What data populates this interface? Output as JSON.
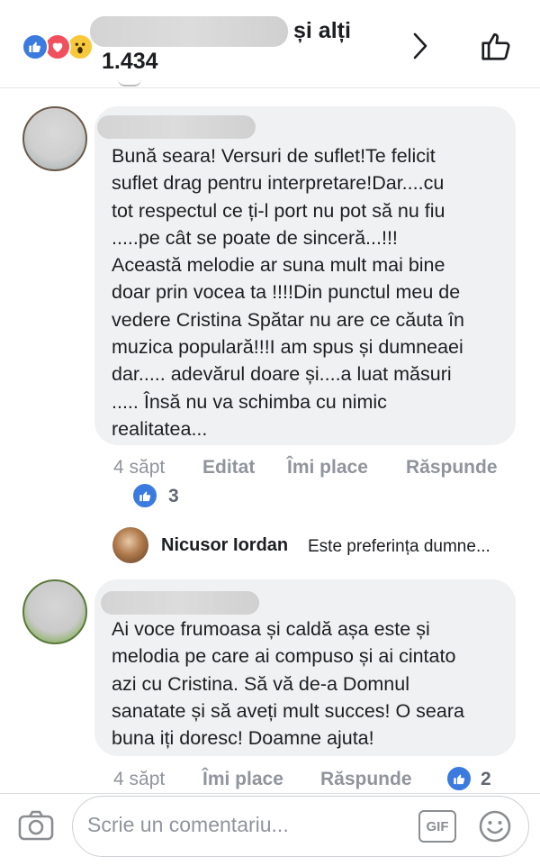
{
  "header": {
    "reactions_suffix": "și alți",
    "reactions_count": "1.434"
  },
  "comments": [
    {
      "text": "Bună seara! Versuri de suflet!Te felicit\nsuflet drag pentru interpretare!Dar....cu\ntot respectul ce ți-l port nu pot să nu fiu\n.....pe cât se poate de sinceră...!!!\nAceastă melodie ar suna mult mai bine\ndoar prin vocea ta !!!!Din punctul meu de\nvedere Cristina Spătar nu are ce căuta în\nmuzica populară!!!I am spus și dumneaei\ndar..... adevărul doare și....a luat măsuri\n..... Însă nu va schimba cu nimic\nrealitatea...",
      "time": "4 săpt",
      "edited": "Editat",
      "like": "Îmi place",
      "reply": "Răspunde",
      "reactions": "3"
    },
    {
      "text": "Ai voce frumoasa și caldă așa este și\nmelodia pe care ai compuso și ai cintato\nazi cu Cristina. Să vă de-a Domnul\nsanatate și să aveți mult succes! O seara\nbuna iți doresc! Doamne ajuta!",
      "time": "4 săpt",
      "like": "Îmi place",
      "reply": "Răspunde",
      "reactions": "2"
    }
  ],
  "reply_preview": {
    "name": "Nicusor Iordan",
    "text": "Este preferința dumne..."
  },
  "composer": {
    "placeholder": "Scrie un comentariu...",
    "gif_label": "GIF"
  },
  "icons": {
    "like": "like-reaction-icon",
    "love": "love-reaction-icon",
    "wow": "wow-reaction-icon",
    "chevron": "chevron-right-icon",
    "thumb": "thumbs-up-icon",
    "camera": "camera-icon",
    "emoji": "emoji-icon"
  },
  "colors": {
    "like_blue": "#3b7be0",
    "love_red": "#f0505e",
    "wow_yellow": "#f7c83a",
    "bubble": "#f0f1f3",
    "meta_gray": "#90949c"
  }
}
